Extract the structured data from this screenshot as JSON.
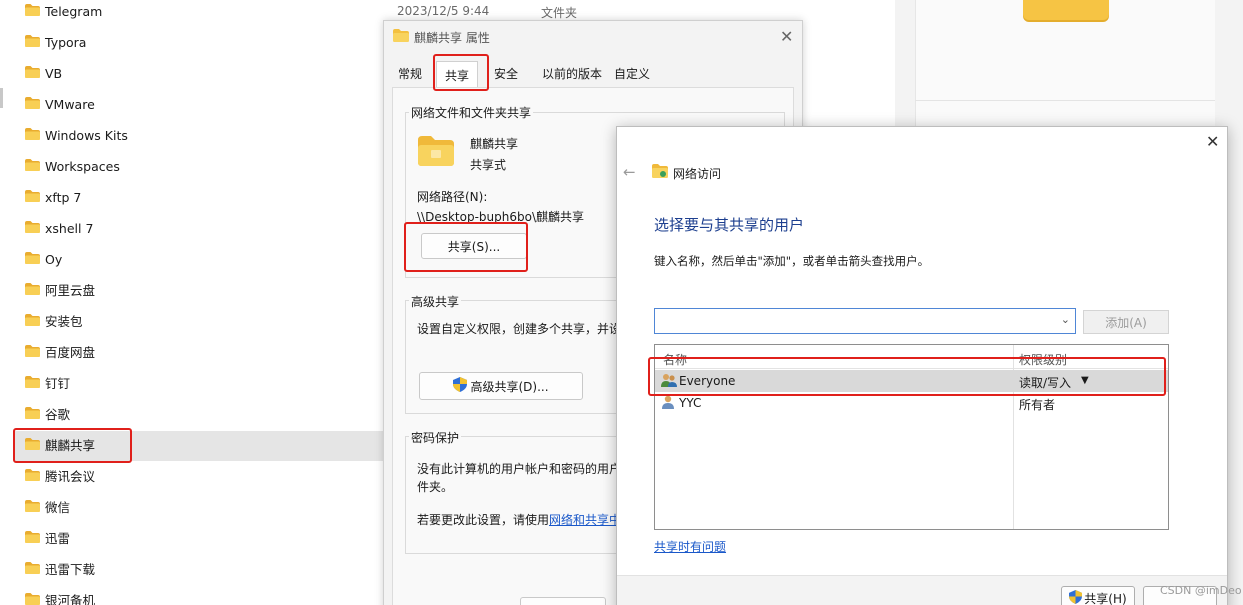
{
  "tree": {
    "items": [
      {
        "label": "Telegram"
      },
      {
        "label": "Typora"
      },
      {
        "label": "VB"
      },
      {
        "label": "VMware"
      },
      {
        "label": "Windows Kits"
      },
      {
        "label": "Workspaces"
      },
      {
        "label": "xftp 7"
      },
      {
        "label": "xshell 7"
      },
      {
        "label": "Oy"
      },
      {
        "label": "阿里云盘"
      },
      {
        "label": "安装包"
      },
      {
        "label": "百度网盘"
      },
      {
        "label": "钉钉"
      },
      {
        "label": "谷歌"
      },
      {
        "label": "麒麟共享"
      },
      {
        "label": "腾讯会议"
      },
      {
        "label": "微信"
      },
      {
        "label": "迅雷"
      },
      {
        "label": "迅雷下载"
      },
      {
        "label": "银河备机"
      }
    ],
    "selected_index": 14
  },
  "top_row": {
    "date": "2023/12/5 9:44",
    "type": "文件夹"
  },
  "properties": {
    "title": "麒麟共享 属性",
    "tabs": [
      "常规",
      "共享",
      "安全",
      "以前的版本",
      "自定义"
    ],
    "active_tab": "共享",
    "network_share_group": "网络文件和文件夹共享",
    "folder_name": "麒麟共享",
    "share_status": "共享式",
    "network_path_label": "网络路径(N):",
    "network_path": "\\\\Desktop-buph6bo\\麒麟共享",
    "share_button": "共享(S)...",
    "advanced_group": "高级共享",
    "advanced_desc": "设置自定义权限，创建多个共享，并设",
    "advanced_button": "高级共享(D)...",
    "password_group": "密码保护",
    "password_desc_line1": "没有此计算机的用户帐户和密码的用户",
    "password_desc_line2": "件夹。",
    "password_change_prefix": "若要更改此设置，请使用",
    "password_change_link": "网络和共享中"
  },
  "network_access": {
    "title": "网络访问",
    "heading": "选择要与其共享的用户",
    "instruction": "键入名称，然后单击\"添加\"，或者单击箭头查找用户。",
    "combo_value": "",
    "add_button": "添加(A)",
    "columns": {
      "name": "名称",
      "permission": "权限级别"
    },
    "rows": [
      {
        "name": "Everyone",
        "permission": "读取/写入",
        "selected": true,
        "has_dropdown": true
      },
      {
        "name": "YYC",
        "permission": "所有者",
        "selected": false,
        "has_dropdown": false
      }
    ],
    "help_link": "共享时有问题",
    "share_button": "共享(H)"
  },
  "watermark": "CSDN @imDeo"
}
